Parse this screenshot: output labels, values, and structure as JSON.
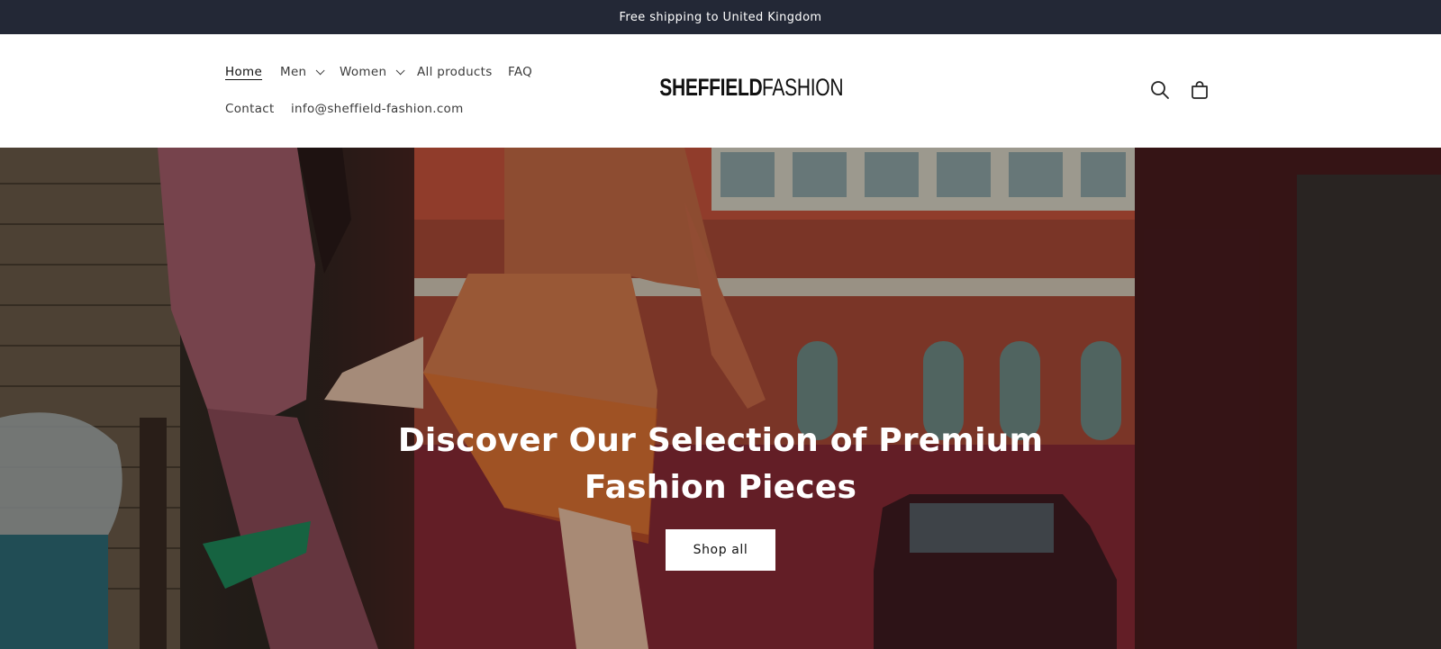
{
  "announcement": {
    "text": "Free shipping to United Kingdom"
  },
  "nav": {
    "home": "Home",
    "men": "Men",
    "women": "Women",
    "all_products": "All products",
    "faq": "FAQ",
    "contact": "Contact",
    "email": "info@sheffield-fashion.com"
  },
  "logo": {
    "strong": "SHEFFIELD",
    "light": "FASHION"
  },
  "header_icons": [
    "search-icon",
    "cart-icon"
  ],
  "hero": {
    "heading_line1": "Discover Our Selection of Premium",
    "heading_line2": "Fashion Pieces",
    "button": "Shop all"
  },
  "colors": {
    "announcement_bg": "#232836",
    "announcement_text": "#ffffff",
    "header_bg": "#ffffff",
    "hero_text": "#ffffff",
    "button_bg": "#ffffff",
    "button_text": "#121212"
  }
}
